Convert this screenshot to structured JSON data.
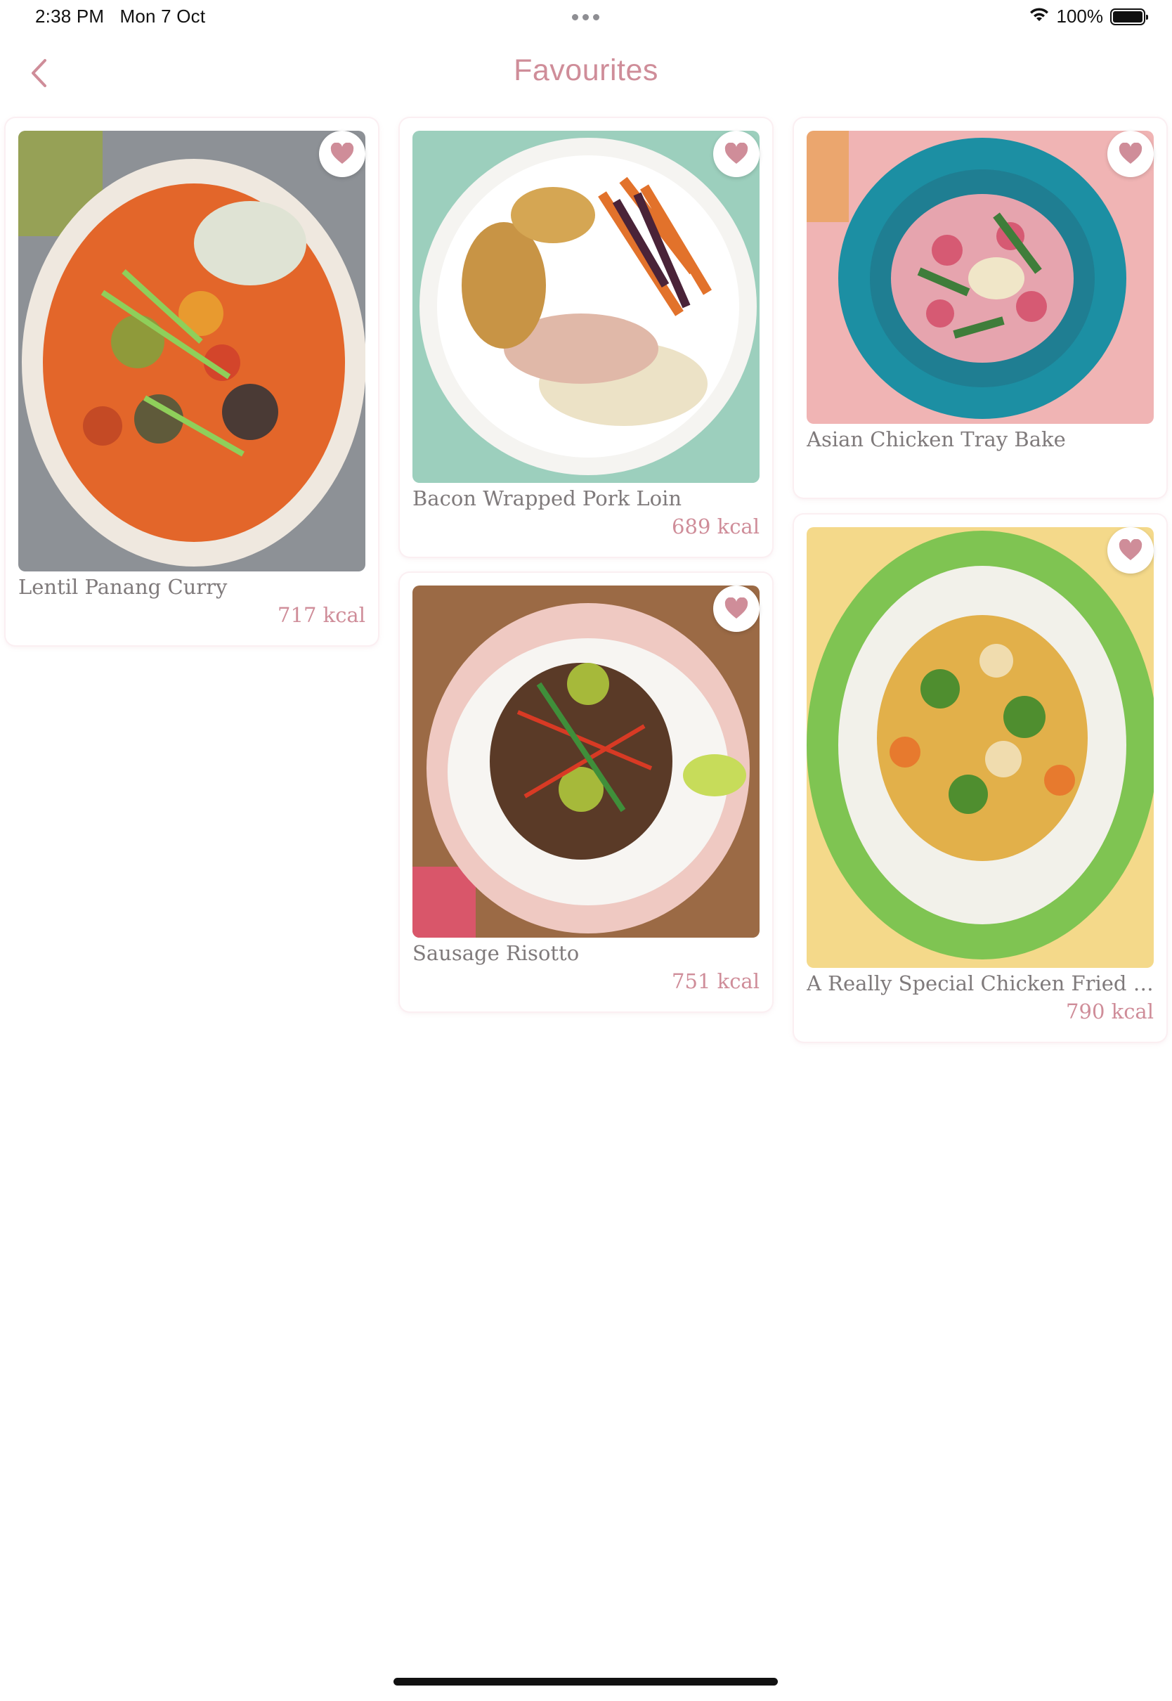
{
  "status_bar": {
    "time": "2:38 PM",
    "date": "Mon 7 Oct",
    "battery_percent": "100%",
    "wifi_icon": "wifi-icon",
    "battery_icon": "battery-icon"
  },
  "nav": {
    "title": "Favourites",
    "back_icon": "chevron-left-icon"
  },
  "colors": {
    "accent": "#cf8d99",
    "text_muted": "#7f7a7b",
    "heart": "#cf8d99"
  },
  "recipes": [
    {
      "name": "Lentil Panang Curry",
      "kcal": "717 kcal",
      "favourite": true
    },
    {
      "name": "Bacon Wrapped Pork Loin",
      "kcal": "689 kcal",
      "favourite": true
    },
    {
      "name": "Asian Chicken Tray Bake",
      "kcal": "",
      "favourite": true
    },
    {
      "name": "Sausage Risotto",
      "kcal": "751 kcal",
      "favourite": true
    },
    {
      "name": "A Really Special Chicken Fried Ri...",
      "kcal": "790 kcal",
      "favourite": true
    }
  ]
}
